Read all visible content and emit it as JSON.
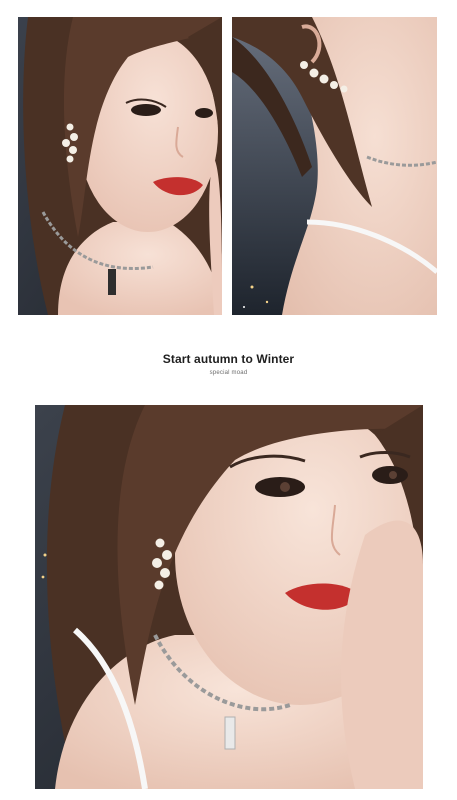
{
  "caption": {
    "title": "Start autumn to Winter",
    "subtitle": "special moad"
  },
  "photos": [
    {
      "id": "top-left",
      "icon": "portrait-photo"
    },
    {
      "id": "top-right",
      "icon": "earring-closeup-photo"
    },
    {
      "id": "bottom",
      "icon": "portrait-photo"
    }
  ],
  "colors": {
    "background": "#ffffff",
    "skin": "#f2d6c9",
    "hair": "#5a3b2c",
    "lips": "#c4302e",
    "pearl": "#f4efe6",
    "chain": "#9a9a9a",
    "backdrop": "#2f3540"
  }
}
